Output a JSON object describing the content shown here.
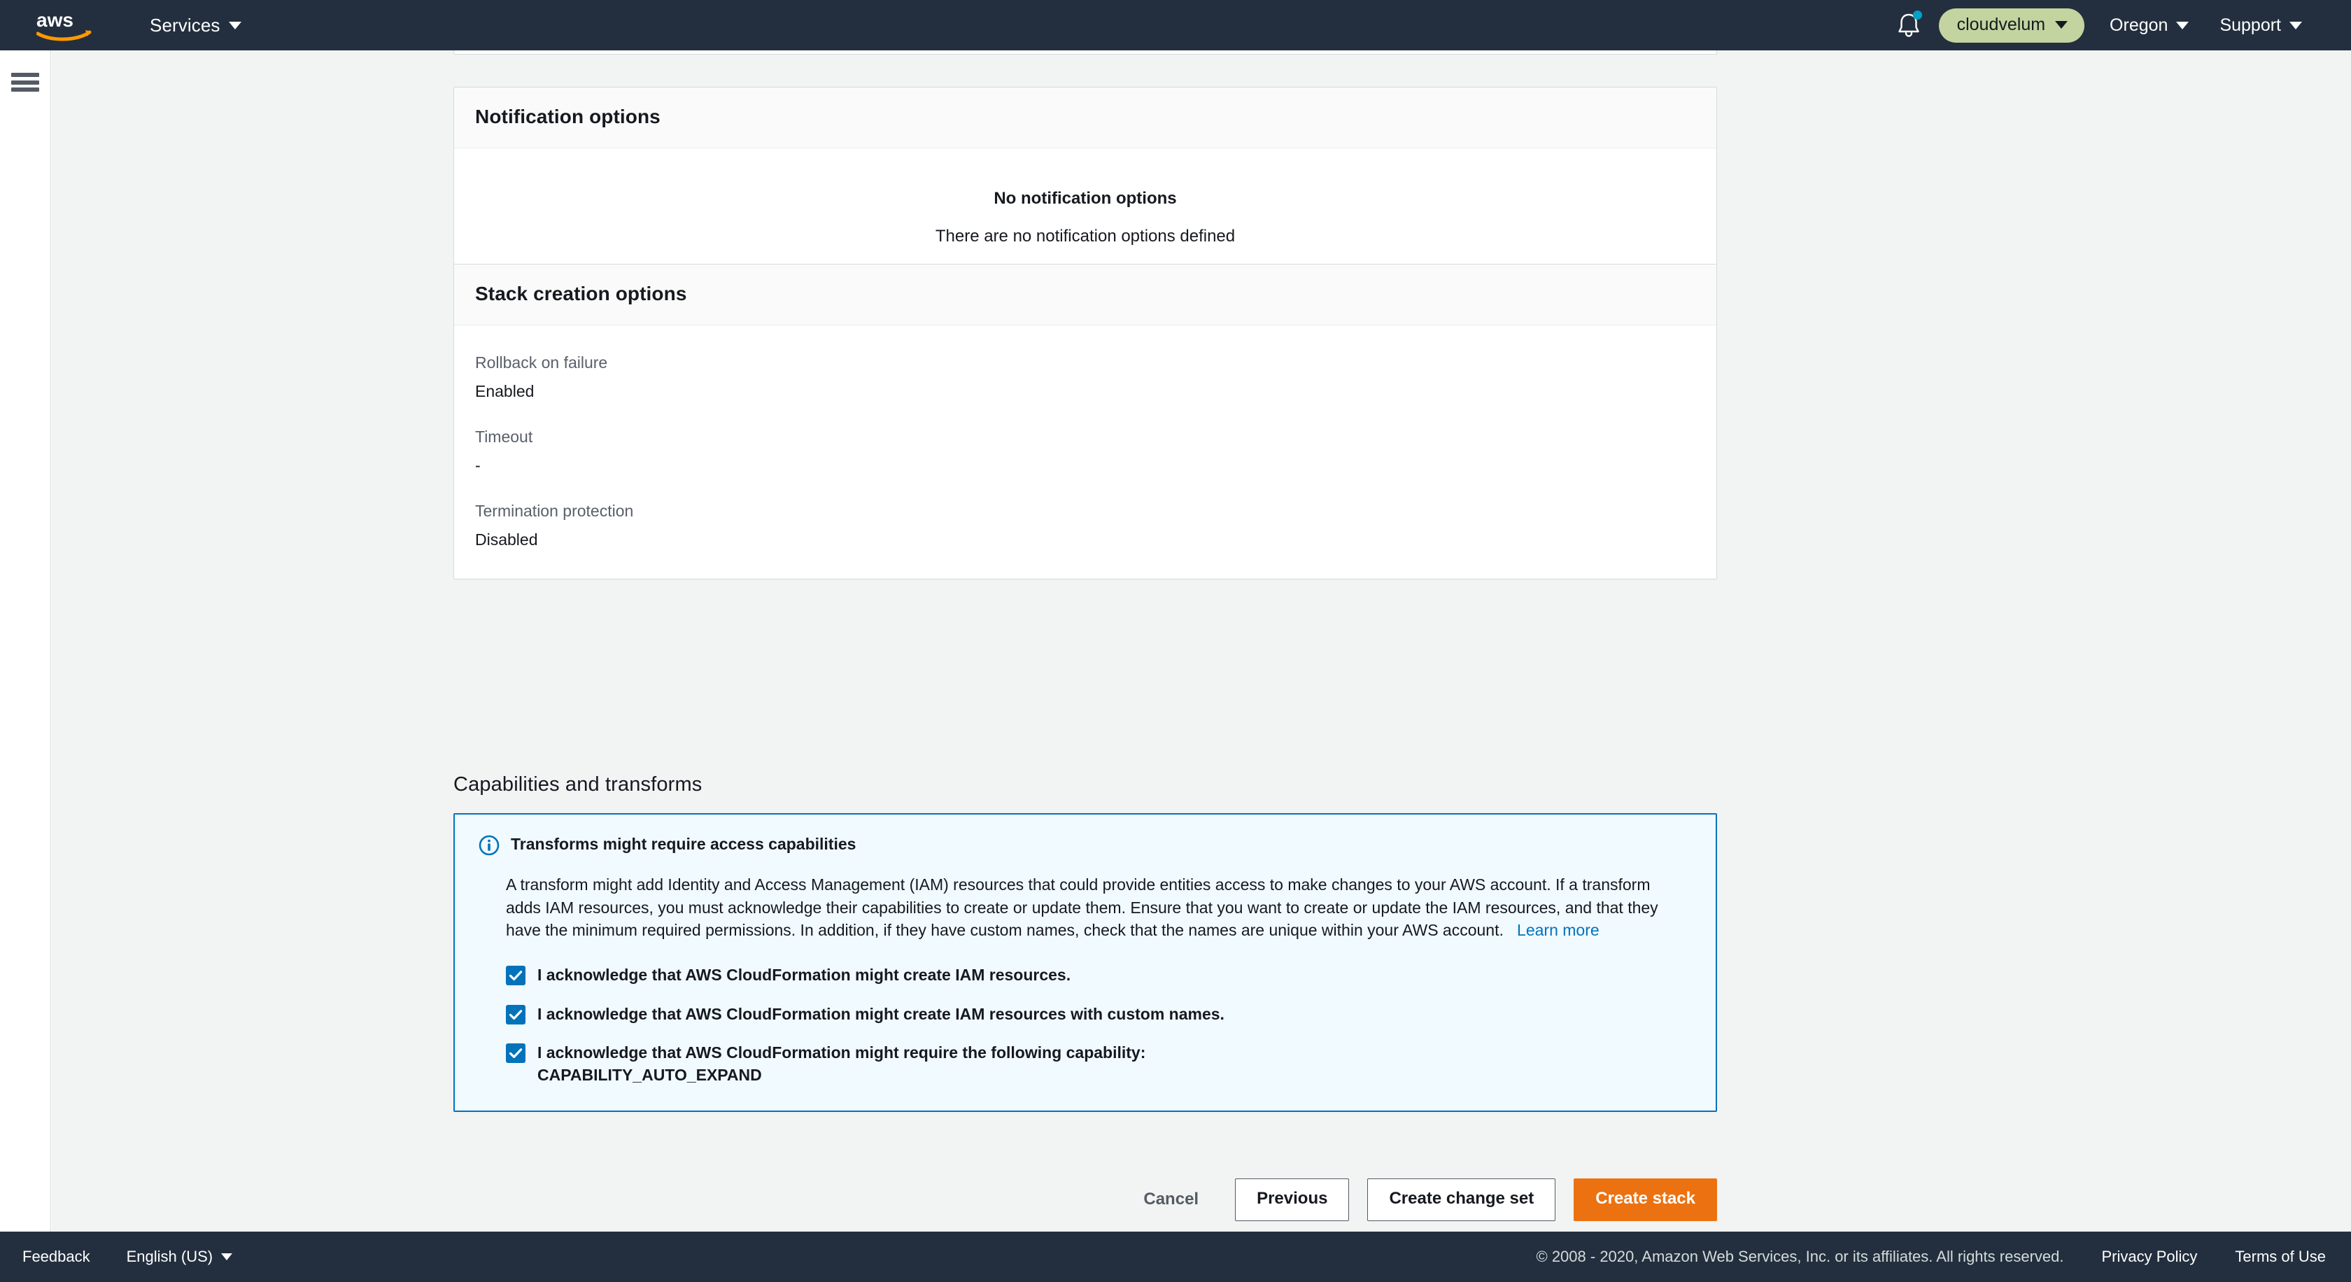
{
  "topnav": {
    "logo_alt": "aws",
    "services_label": "Services",
    "bell_label": "Notifications",
    "account_label": "cloudvelum",
    "region_label": "Oregon",
    "support_label": "Support"
  },
  "notification_options": {
    "title": "Notification options",
    "empty_title": "No notification options",
    "empty_subtitle": "There are no notification options defined"
  },
  "stack_creation_options": {
    "title": "Stack creation options",
    "rows": [
      {
        "label": "Rollback on failure",
        "value": "Enabled"
      },
      {
        "label": "Timeout",
        "value": "-"
      },
      {
        "label": "Termination protection",
        "value": "Disabled"
      }
    ]
  },
  "capabilities": {
    "heading": "Capabilities and transforms",
    "alert_title": "Transforms might require access capabilities",
    "alert_body": "A transform might add Identity and Access Management (IAM) resources that could provide entities access to make changes to your AWS account. If a transform adds IAM resources, you must acknowledge their capabilities to create or update them. Ensure that you want to create or update the IAM resources, and that they have the minimum required permissions. In addition, if they have custom names, check that the names are unique within your AWS account.",
    "learn_more": "Learn more",
    "acknowledgements": [
      {
        "label": "I acknowledge that AWS CloudFormation might create IAM resources.",
        "checked": true
      },
      {
        "label": "I acknowledge that AWS CloudFormation might create IAM resources with custom names.",
        "checked": true
      },
      {
        "label": "I acknowledge that AWS CloudFormation might require the following capability: CAPABILITY_AUTO_EXPAND",
        "checked": true
      }
    ]
  },
  "actions": {
    "cancel": "Cancel",
    "previous": "Previous",
    "create_change_set": "Create change set",
    "create_stack": "Create stack"
  },
  "footer": {
    "feedback": "Feedback",
    "language": "English (US)",
    "copyright": "© 2008 - 2020, Amazon Web Services, Inc. or its affiliates. All rights reserved.",
    "privacy": "Privacy Policy",
    "terms": "Terms of Use"
  },
  "colors": {
    "nav_bg": "#232f3e",
    "accent_orange": "#ec7211",
    "link_blue": "#0073bb",
    "account_pill": "#c3d4a0",
    "alert_bg": "#f1faff",
    "page_bg": "#f2f3f3"
  }
}
